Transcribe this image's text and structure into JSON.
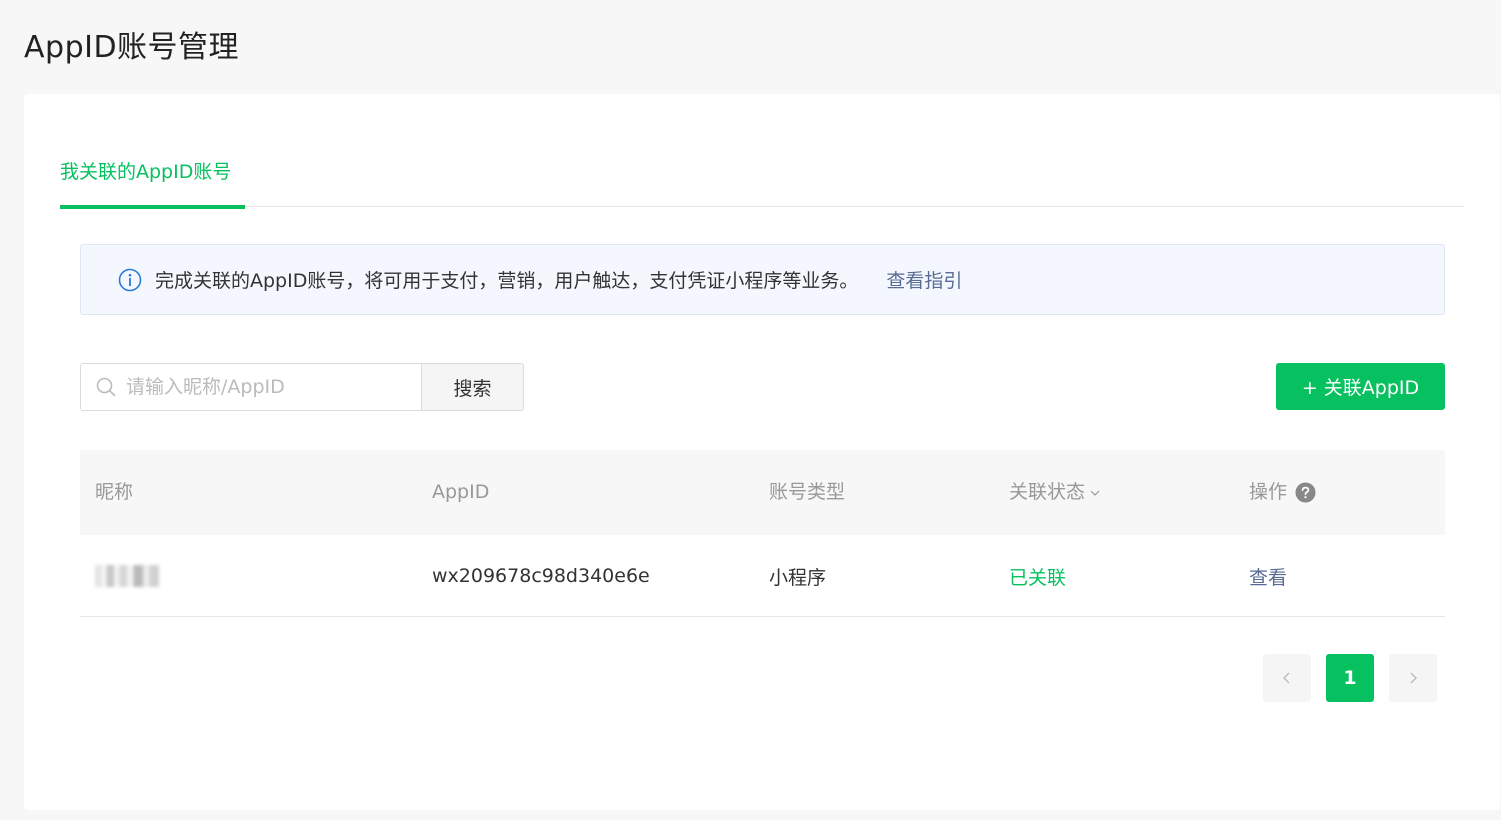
{
  "page": {
    "title": "AppID账号管理"
  },
  "tabs": [
    {
      "label": "我关联的AppID账号",
      "active": true
    }
  ],
  "notice": {
    "text": "完成关联的AppID账号，将可用于支付，营销，用户触达，支付凭证小程序等业务。",
    "link": "查看指引"
  },
  "search": {
    "placeholder": "请输入昵称/AppID",
    "value": "",
    "button": "搜索"
  },
  "add_button": "+ 关联AppID",
  "table": {
    "headers": {
      "nickname": "昵称",
      "appid": "AppID",
      "type": "账号类型",
      "status": "关联状态",
      "action": "操作"
    },
    "rows": [
      {
        "nickname": "",
        "appid": "wx209678c98d340e6e",
        "type": "小程序",
        "status": "已关联",
        "action": "查看"
      }
    ]
  },
  "pagination": {
    "current": "1"
  },
  "colors": {
    "accent": "#07c160",
    "link": "#576b95",
    "notice_bg": "#f4f8fe"
  }
}
